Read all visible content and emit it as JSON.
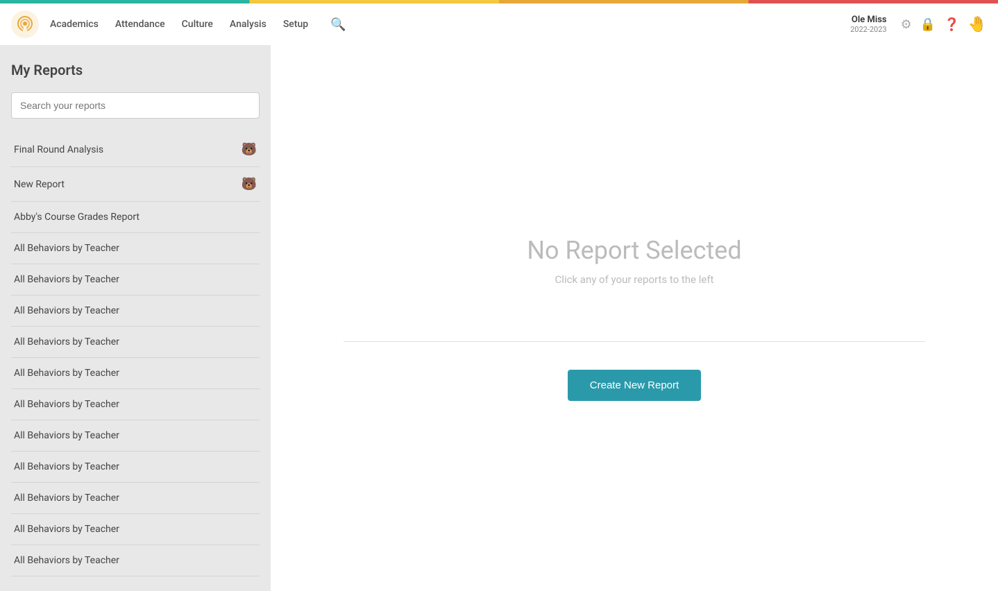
{
  "topbar": {
    "colors": [
      "#2bb5a0",
      "#f5c842",
      "#e8a838",
      "#e05252"
    ]
  },
  "header": {
    "nav": [
      {
        "label": "Academics",
        "id": "academics"
      },
      {
        "label": "Attendance",
        "id": "attendance"
      },
      {
        "label": "Culture",
        "id": "culture"
      },
      {
        "label": "Analysis",
        "id": "analysis"
      },
      {
        "label": "Setup",
        "id": "setup"
      }
    ],
    "user_name": "Ole Miss",
    "user_year": "2022-2023"
  },
  "sidebar": {
    "title": "My Reports",
    "search_placeholder": "Search your reports",
    "reports": [
      {
        "name": "Final Round Analysis",
        "has_icon": true
      },
      {
        "name": "New Report",
        "has_icon": true
      },
      {
        "name": "Abby's Course Grades Report",
        "has_icon": false
      },
      {
        "name": "All Behaviors by Teacher",
        "has_icon": false
      },
      {
        "name": "All Behaviors by Teacher",
        "has_icon": false
      },
      {
        "name": "All Behaviors by Teacher",
        "has_icon": false
      },
      {
        "name": "All Behaviors by Teacher",
        "has_icon": false
      },
      {
        "name": "All Behaviors by Teacher",
        "has_icon": false
      },
      {
        "name": "All Behaviors by Teacher",
        "has_icon": false
      },
      {
        "name": "All Behaviors by Teacher",
        "has_icon": false
      },
      {
        "name": "All Behaviors by Teacher",
        "has_icon": false
      },
      {
        "name": "All Behaviors by Teacher",
        "has_icon": false
      },
      {
        "name": "All Behaviors by Teacher",
        "has_icon": false
      },
      {
        "name": "All Behaviors by Teacher",
        "has_icon": false
      }
    ]
  },
  "main": {
    "no_report_title": "No Report Selected",
    "no_report_subtitle": "Click any of your reports to the left",
    "create_btn_label": "Create New Report"
  }
}
